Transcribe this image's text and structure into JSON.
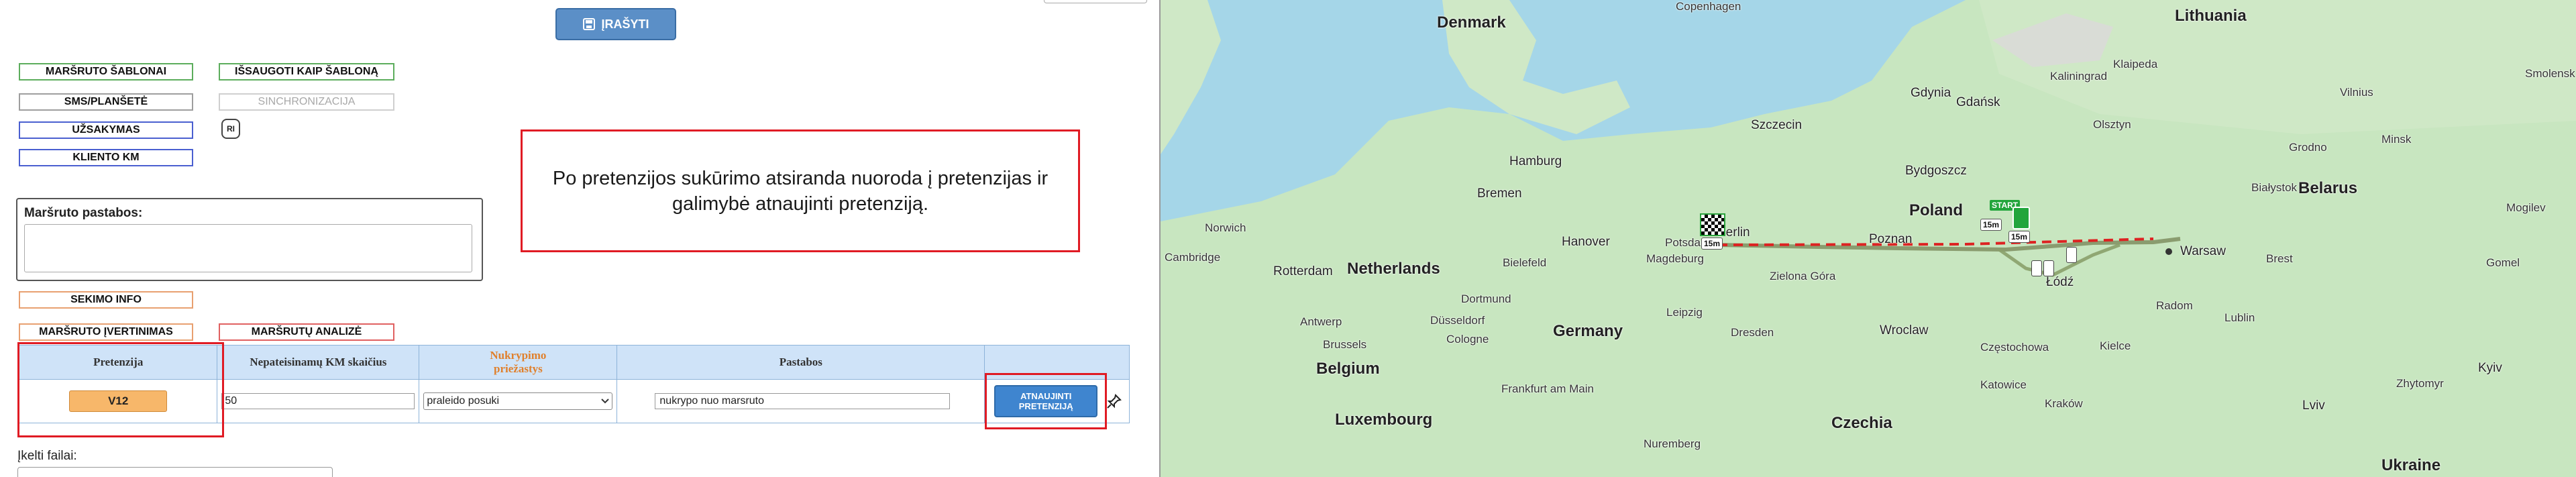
{
  "toolbar": {
    "save_label": "ĮRAŠYTI"
  },
  "buttons": {
    "route_templates": "MARŠRUTO ŠABLONAI",
    "save_as_template": "IŠSAUGOTI KAIP ŠABLONĄ",
    "sms_tablet": "SMS/PLANŠETĖ",
    "sync": "SINCHRONIZACIJA",
    "order": "UŽSAKYMAS",
    "client_km": "KLIENTO KM",
    "tracking_info": "SEKIMO INFO",
    "route_evaluation": "MARŠRUTO ĮVERTINIMAS",
    "route_analysis": "MARŠRUTŲ ANALIZĖ"
  },
  "badge": {
    "text": "RI"
  },
  "notes": {
    "label": "Maršruto pastabos:",
    "value": ""
  },
  "callout": {
    "text": "Po pretenzijos sukūrimo atsiranda nuoroda į pretenzijas ir galimybė atnaujinti pretenziją."
  },
  "claims_table": {
    "headers": {
      "claim": "Pretenzija",
      "km": "Nepateisinamų KM skaičius",
      "reason": "Nukrypimo priežastys",
      "notes": "Pastabos"
    },
    "row": {
      "claim_id": "V12",
      "km_value": "50",
      "reason_value": "praleido posuki",
      "notes_value": "nukrypo nuo marsruto",
      "renew_label": "ATNAUJINTI PRETENZIJĄ"
    }
  },
  "files": {
    "label": "Įkelti failai:"
  },
  "map": {
    "countries": [
      "Denmark",
      "Lithuania",
      "Netherlands",
      "Poland",
      "Belarus",
      "Belgium",
      "Germany",
      "Luxembourg",
      "Czechia",
      "Ukraine"
    ],
    "cities": [
      "Copenhagen",
      "Klaipeda",
      "Vilnius",
      "Minsk",
      "Hamburg",
      "Szczecin",
      "Gdańsk",
      "Gdynia",
      "Bydgoszcz",
      "Berlin",
      "Poznan",
      "Warsaw",
      "Łódź",
      "Bremen",
      "Hanover",
      "Magdeburg",
      "Potsdam",
      "Rotterdam",
      "Antwerp",
      "Brussels",
      "Dortmund",
      "Düsseldorf",
      "Cologne",
      "Bielefeld",
      "Leipzig",
      "Dresden",
      "Wroclaw",
      "Częstochowa",
      "Katowice",
      "Kraków",
      "Lublin",
      "Kielce",
      "Radom",
      "Brest",
      "Lviv",
      "Kyiv",
      "Zhytomyr",
      "Frankfurt am Main",
      "Nuremberg",
      "Kaliningrad",
      "Grodno",
      "Norwich",
      "Cambridge",
      "Olsztyn",
      "Zielona Góra",
      "Białystok",
      "Gomel",
      "Mogilev",
      "Smolensk"
    ],
    "markers": {
      "start": "START",
      "time_a": "15m",
      "time_b": "15m",
      "time_c": "15m"
    }
  }
}
